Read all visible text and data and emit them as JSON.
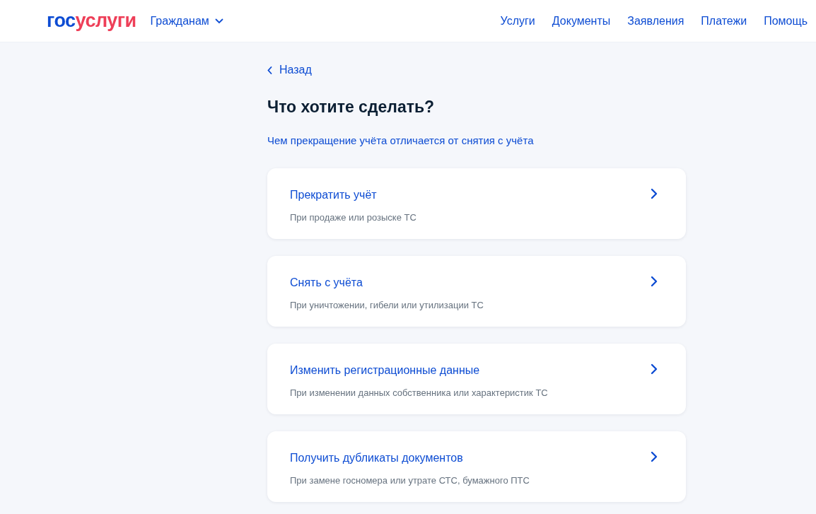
{
  "header": {
    "logo": [
      {
        "text": "гос",
        "color": "#0d4cd3"
      },
      {
        "text": "услуги",
        "color": "#ee3f58"
      }
    ],
    "audience_menu": {
      "label": "Гражданам",
      "expanded": false
    },
    "nav": [
      "Услуги",
      "Документы",
      "Заявления",
      "Платежи",
      "Помощь"
    ]
  },
  "back_link": "Назад",
  "title": "Что хотите сделать?",
  "info_link": "Чем прекращение учёта отличается от снятия с учёта",
  "options": [
    {
      "title": "Прекратить учёт",
      "subtitle": "При продаже или розыске ТС"
    },
    {
      "title": "Снять с учёта",
      "subtitle": "При уничтожении, гибели или утилизации ТС"
    },
    {
      "title": "Изменить регистрационные данные",
      "subtitle": "При изменении данных собственника или характеристик ТС"
    },
    {
      "title": "Получить дубликаты документов",
      "subtitle": "При замене госномера или утрате СТС, бумажного ПТС"
    }
  ]
}
